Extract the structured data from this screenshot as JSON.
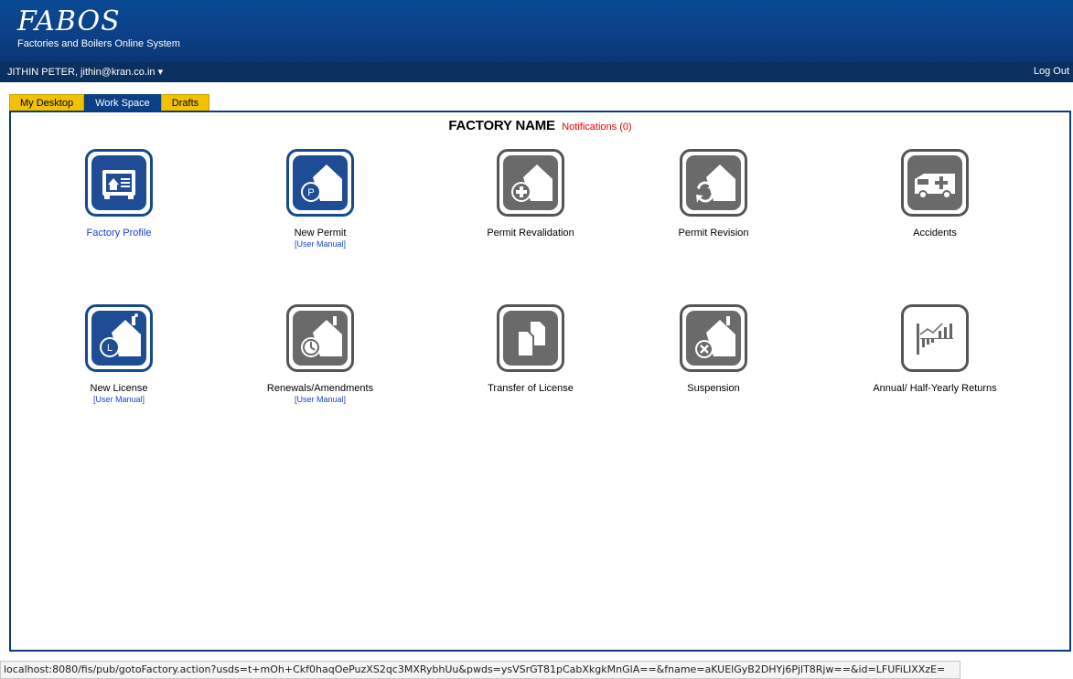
{
  "header": {
    "logo_title": "FABOS",
    "logo_subtitle": "Factories and Boilers Online System"
  },
  "userbar": {
    "user": "JITHIN PETER, jithin@kran.co.in",
    "dropdown_glyph": "▾",
    "logout": "Log Out"
  },
  "tabs": [
    {
      "label": "My Desktop",
      "active": false
    },
    {
      "label": "Work Space",
      "active": true
    },
    {
      "label": "Drafts",
      "active": false
    }
  ],
  "panel": {
    "factory_name": "FACTORY NAME",
    "notifications": "Notifications (0)"
  },
  "items": [
    {
      "label": "Factory Profile",
      "icon": "factory-profile-icon",
      "active": true,
      "manual": ""
    },
    {
      "label": "New Permit",
      "icon": "new-permit-icon",
      "active": true,
      "manual": "[User Manual]"
    },
    {
      "label": "Permit Revalidation",
      "icon": "permit-revalidation-icon",
      "active": false,
      "manual": ""
    },
    {
      "label": "Permit Revision",
      "icon": "permit-revision-icon",
      "active": false,
      "manual": ""
    },
    {
      "label": "Accidents",
      "icon": "ambulance-icon",
      "active": false,
      "manual": ""
    },
    {
      "label": "New License",
      "icon": "new-license-icon",
      "active": true,
      "manual": "[User Manual]"
    },
    {
      "label": "Renewals/Amendments",
      "icon": "renewals-amendments-icon",
      "active": false,
      "manual": "[User Manual]"
    },
    {
      "label": "Transfer of License",
      "icon": "transfer-license-icon",
      "active": false,
      "manual": ""
    },
    {
      "label": "Suspension",
      "icon": "suspension-icon",
      "active": false,
      "manual": ""
    },
    {
      "label": "Annual/ Half-Yearly Returns",
      "icon": "returns-chart-icon",
      "active": false,
      "manual": ""
    }
  ],
  "statusbar": {
    "url": "localhost:8080/fis/pub/gotoFactory.action?usds=t+mOh+Ckf0haqOePuzXS2qc3MXRybhUu&pwds=ysVSrGT81pCabXkgkMnGlA==&fname=aKUElGyB2DHYj6PjlT8Rjw==&id=LFUFiLIXXzE="
  },
  "colors": {
    "header_blue": "#0c3f86",
    "tab_yellow": "#f2c100",
    "active_icon_blue": "#1e4d96",
    "inactive_icon_grey": "#6a6a6a",
    "link_blue": "#1a3fcf",
    "notification_red": "#e00000"
  }
}
